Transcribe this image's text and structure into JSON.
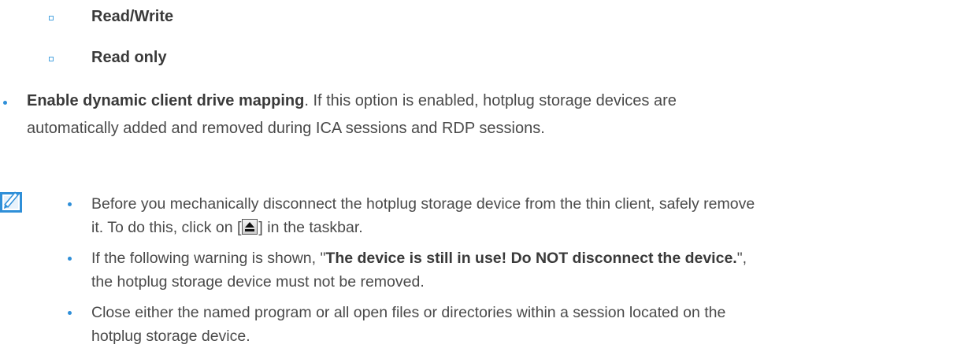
{
  "options": [
    {
      "label": "Read/Write"
    },
    {
      "label": "Read only"
    }
  ],
  "setting": {
    "name": "Enable dynamic client drive mapping",
    "line1_rest": ". If this option is enabled, hotplug storage devices are",
    "line2": "automatically added and removed during ICA sessions and RDP sessions."
  },
  "notes": {
    "icon": "note-pencil-icon",
    "item1": {
      "line1": "Before you mechanically disconnect the hotplug storage device from the thin client, safely remove",
      "line2_pre": "it. To do this, click on [",
      "eject_icon": "eject-icon",
      "line2_post": "] in the taskbar."
    },
    "item2": {
      "line1_pre": "If the following warning is shown, \"",
      "warning": "The device is still in use! Do NOT disconnect the device.",
      "line1_post": "\",",
      "line2": "the hotplug storage device must not be removed."
    },
    "item3": {
      "line1": "Close either the named program or all open files or directories within a session located on the",
      "line2": "hotplug storage device."
    }
  },
  "colors": {
    "accent": "#2f8fd8",
    "text": "#4a4a4a"
  }
}
